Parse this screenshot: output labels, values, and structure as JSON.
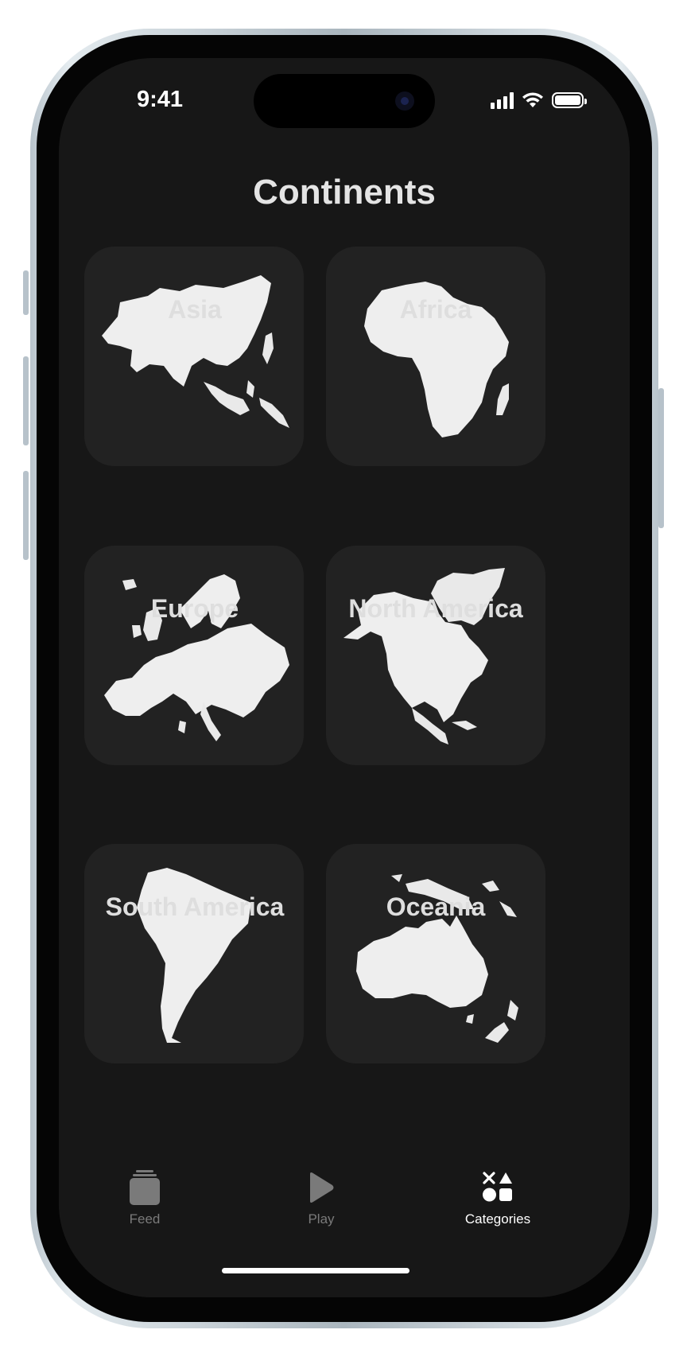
{
  "status_bar": {
    "time": "9:41"
  },
  "page_title": "Continents",
  "continents": [
    {
      "label": "Asia"
    },
    {
      "label": "Africa"
    },
    {
      "label": "Europe"
    },
    {
      "label": "North America"
    },
    {
      "label": "South America"
    },
    {
      "label": "Oceania"
    }
  ],
  "tab_bar": {
    "items": [
      {
        "label": "Feed",
        "icon": "stack-icon",
        "selected": false
      },
      {
        "label": "Play",
        "icon": "play-icon",
        "selected": false
      },
      {
        "label": "Categories",
        "icon": "shapes-icon",
        "selected": true
      }
    ]
  },
  "colors": {
    "background": "#171717",
    "tile": "#222222",
    "active_tab": "#ffffff",
    "inactive_tab": "#7a7a7a"
  }
}
